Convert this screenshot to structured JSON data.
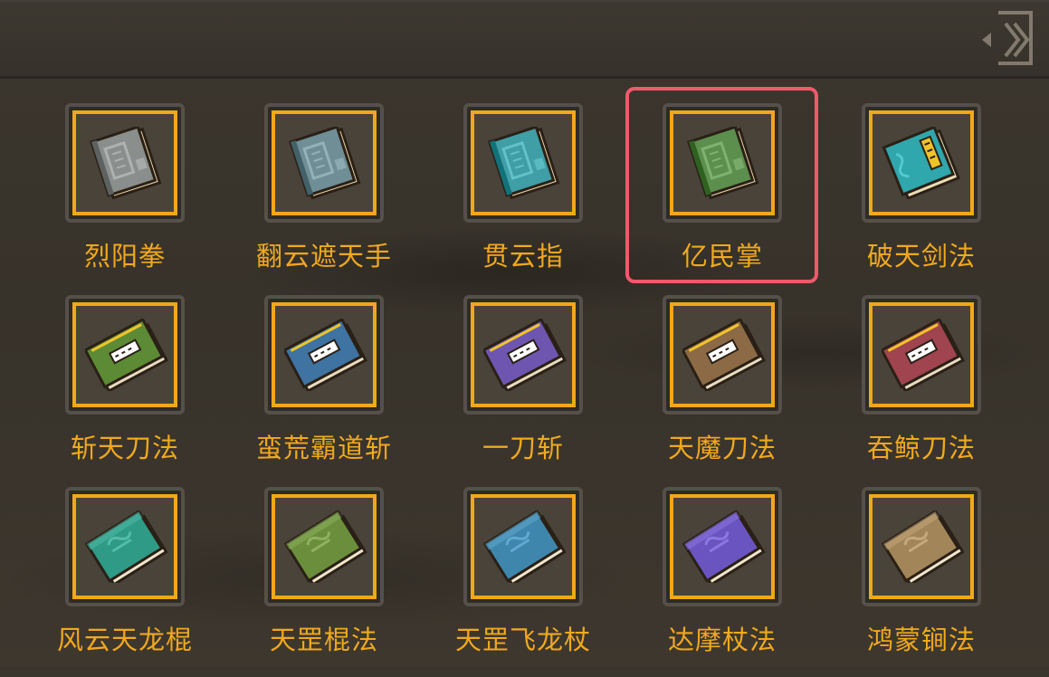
{
  "colors": {
    "accent_gold": "#f2a81a",
    "label_gold": "#f0a91e",
    "highlight": "#ef5a6a",
    "background": "#3a352d"
  },
  "header": {
    "back_icon": "back-arrow-icon"
  },
  "selected_index": 3,
  "items": [
    {
      "label": "烈阳拳",
      "style": "scroll",
      "cover": "#8a8e8c",
      "icon": "scroll-book-icon"
    },
    {
      "label": "翻云遮天手",
      "style": "scroll",
      "cover": "#6f8e96",
      "icon": "scroll-book-icon"
    },
    {
      "label": "贯云指",
      "style": "scroll",
      "cover": "#3f9ea6",
      "icon": "scroll-book-icon"
    },
    {
      "label": "亿民掌",
      "style": "scroll",
      "cover": "#5c8e4e",
      "icon": "scroll-book-icon"
    },
    {
      "label": "破天剑法",
      "style": "tome",
      "cover": "#2fa7ac",
      "icon": "sword-manual-icon"
    },
    {
      "label": "斩天刀法",
      "style": "blade",
      "cover": "#5d8a35",
      "icon": "blade-manual-icon"
    },
    {
      "label": "蛮荒霸道斩",
      "style": "blade",
      "cover": "#3e73a2",
      "icon": "blade-manual-icon"
    },
    {
      "label": "一刀斩",
      "style": "blade",
      "cover": "#6e56b0",
      "icon": "blade-manual-icon"
    },
    {
      "label": "天魔刀法",
      "style": "blade",
      "cover": "#8c6a46",
      "icon": "blade-manual-icon"
    },
    {
      "label": "吞鲸刀法",
      "style": "blade",
      "cover": "#a0444f",
      "icon": "blade-manual-icon"
    },
    {
      "label": "风云天龙棍",
      "style": "staff",
      "cover": "#2f9a86",
      "icon": "staff-manual-icon"
    },
    {
      "label": "天罡棍法",
      "style": "staff",
      "cover": "#6b8e3c",
      "icon": "staff-manual-icon"
    },
    {
      "label": "天罡飞龙杖",
      "style": "staff",
      "cover": "#3f86ad",
      "icon": "staff-manual-icon"
    },
    {
      "label": "达摩杖法",
      "style": "staff",
      "cover": "#6a55c0",
      "icon": "staff-manual-icon"
    },
    {
      "label": "鸿蒙锏法",
      "style": "staff",
      "cover": "#a2865a",
      "icon": "staff-manual-icon"
    }
  ]
}
